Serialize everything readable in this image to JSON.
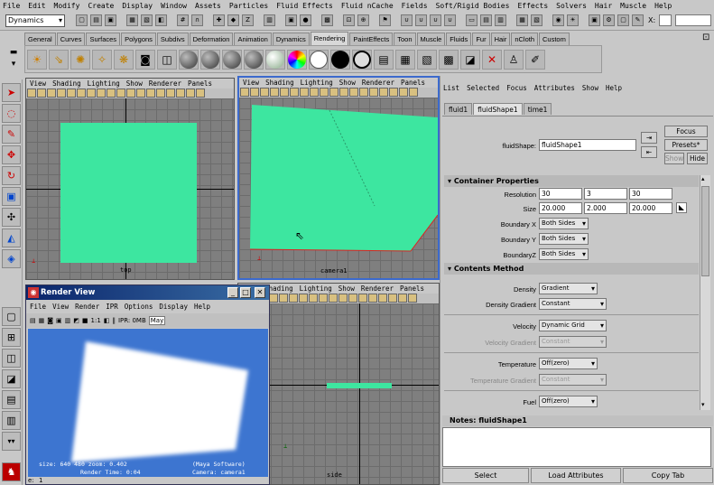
{
  "menubar": [
    "File",
    "Edit",
    "Modify",
    "Create",
    "Display",
    "Window",
    "Assets",
    "Particles",
    "Fluid Effects",
    "Fluid nCache",
    "Fields",
    "Soft/Rigid Bodies",
    "Effects",
    "Solvers",
    "Hair",
    "Muscle",
    "Help"
  ],
  "status": {
    "mode": "Dynamics",
    "x_label": "X:"
  },
  "shelf_tabs": [
    "General",
    "Curves",
    "Surfaces",
    "Polygons",
    "Subdivs",
    "Deformation",
    "Animation",
    "Dynamics",
    "Rendering",
    "PaintEffects",
    "Toon",
    "Muscle",
    "Fluids",
    "Fur",
    "Hair",
    "nCloth",
    "Custom"
  ],
  "shelf_active": "Rendering",
  "viewport_menu": [
    "View",
    "Shading",
    "Lighting",
    "Show",
    "Renderer",
    "Panels"
  ],
  "viewports": {
    "top": {
      "label": "top"
    },
    "camera": {
      "label": "camera1"
    },
    "side": {
      "label": "side"
    }
  },
  "render_view": {
    "title": "Render View",
    "menu": [
      "File",
      "View",
      "Render",
      "IPR",
      "Options",
      "Display",
      "Help"
    ],
    "toolbar": {
      "ratio": "1:1",
      "ipr": "IPR: 0MB",
      "may": "May"
    },
    "status_line1": "size:  640  480 zoom: 0.402",
    "status_line2": "Render Time: 0:04",
    "status_right1": "(Maya Software)",
    "status_right2": "Camera: camera1",
    "frame": "1",
    "frame_label": "e:"
  },
  "attribute_editor": {
    "menu": [
      "List",
      "Selected",
      "Focus",
      "Attributes",
      "Show",
      "Help"
    ],
    "tabs": [
      "fluid1",
      "fluidShape1",
      "time1"
    ],
    "active_tab": "fluidShape1",
    "shape_label": "fluidShape:",
    "shape_value": "fluidShape1",
    "focus": "Focus",
    "presets": "Presets*",
    "show": "Show",
    "hide": "Hide",
    "container": {
      "title": "Container Properties",
      "resolution_label": "Resolution",
      "resolution": [
        "30",
        "3",
        "30"
      ],
      "size_label": "Size",
      "size": [
        "20.000",
        "2.000",
        "20.000"
      ],
      "boundary_x_label": "Boundary X",
      "boundary_x": "Both Sides",
      "boundary_y_label": "Boundary Y",
      "boundary_y": "Both Sides",
      "boundary_z_label": "BoundaryZ",
      "boundary_z": "Both Sides"
    },
    "contents": {
      "title": "Contents Method",
      "density_label": "Density",
      "density": "Gradient",
      "density_gradient_label": "Density Gradient",
      "density_gradient": "Constant",
      "velocity_label": "Velocity",
      "velocity": "Dynamic Grid",
      "velocity_gradient_label": "Velocity Gradient",
      "velocity_gradient": "Constant",
      "temperature_label": "Temperature",
      "temperature": "Off(zero)",
      "temperature_gradient_label": "Temperature Gradient",
      "temperature_gradient": "Constant",
      "fuel_label": "Fuel",
      "fuel": "Off(zero)"
    },
    "notes_label": "Notes:  fluidShape1",
    "buttons": [
      "Select",
      "Load Attributes",
      "Copy Tab"
    ]
  },
  "colors": {
    "fluid": "#3de6a0",
    "render_bg": "#3d75d0",
    "title_bar": "#0a246a"
  }
}
